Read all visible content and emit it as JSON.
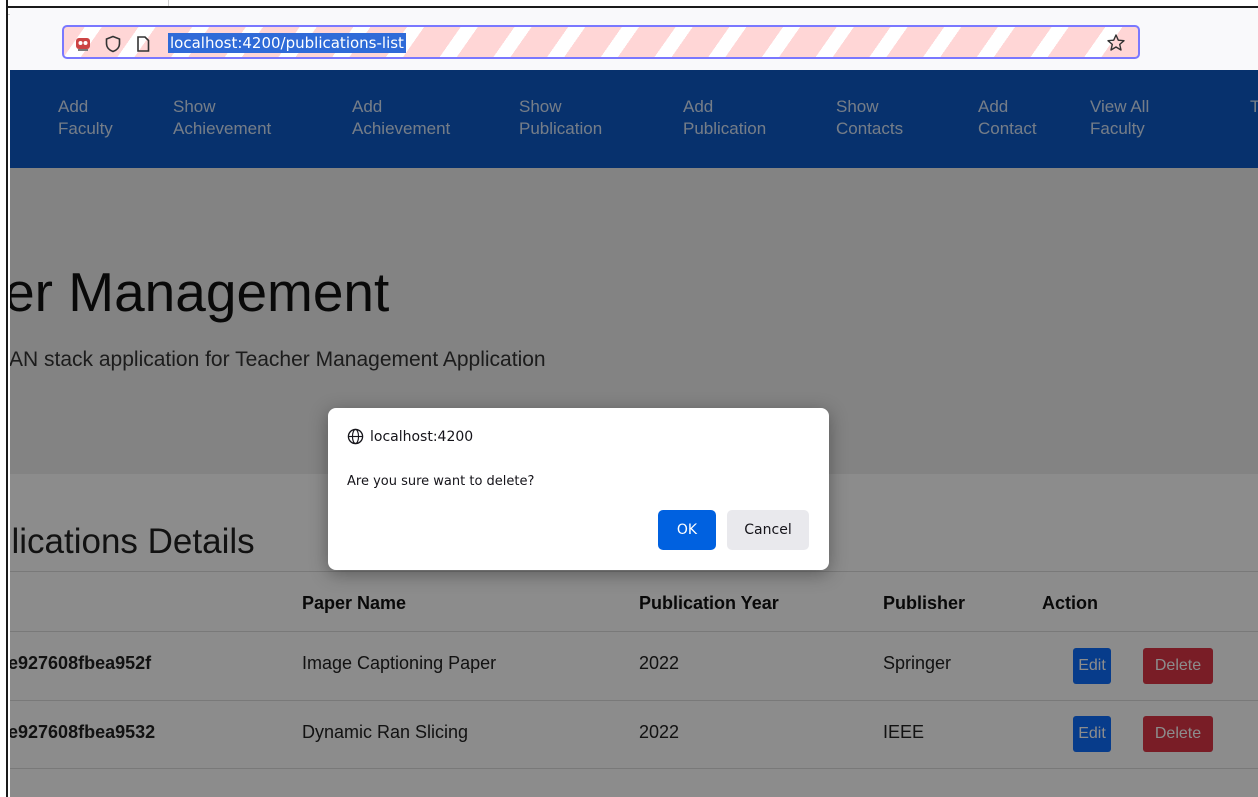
{
  "browser": {
    "url": "localhost:4200/publications-list",
    "icons": [
      "extension-icon",
      "shield-icon",
      "page-icon",
      "bookmark-star-icon"
    ]
  },
  "nav": {
    "items": [
      {
        "line1": "Add",
        "line2": "Faculty"
      },
      {
        "line1": "Show",
        "line2": "Achievement"
      },
      {
        "line1": "Add",
        "line2": "Achievement"
      },
      {
        "line1": "Show",
        "line2": "Publication"
      },
      {
        "line1": "Add",
        "line2": "Publication"
      },
      {
        "line1": "Show",
        "line2": "Contacts"
      },
      {
        "line1": "Add",
        "line2": "Contact"
      },
      {
        "line1": "View All",
        "line2": "Faculty"
      },
      {
        "line1": "T",
        "line2": ""
      }
    ]
  },
  "page": {
    "title": "cher Management",
    "subtitle": "EAN stack application for Teacher Management Application",
    "section_title": "blications Details"
  },
  "table": {
    "headers": [
      "",
      "Paper Name",
      "Publication Year",
      "Publisher",
      "Action"
    ],
    "rows": [
      {
        "id": "e927608fbea952f",
        "paper": "Image Captioning Paper",
        "year": "2022",
        "publisher": "Springer"
      },
      {
        "id": "e927608fbea9532",
        "paper": "Dynamic Ran Slicing",
        "year": "2022",
        "publisher": "IEEE"
      }
    ],
    "edit_label": "Edit",
    "delete_label": "Delete"
  },
  "dialog": {
    "origin": "localhost:4200",
    "message": "Are you sure want to delete?",
    "ok_label": "OK",
    "cancel_label": "Cancel"
  },
  "colors": {
    "navbar": "#0d5ac7",
    "ok_button": "#0061e0",
    "edit_button": "#0d6efd",
    "delete_button": "#dc3545"
  }
}
